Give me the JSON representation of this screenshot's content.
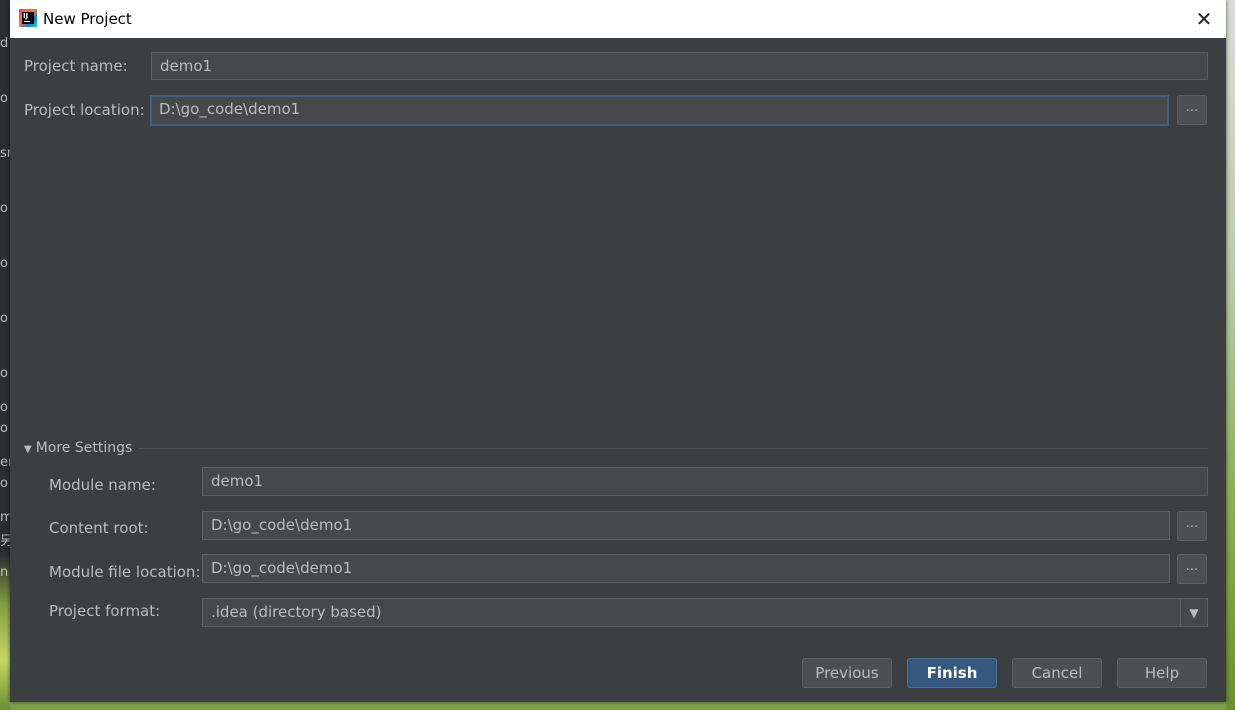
{
  "window": {
    "title": "New Project"
  },
  "background": {
    "left_chars": [
      "d",
      "o",
      "sr",
      "o",
      "o",
      "o",
      "o",
      "o",
      "o",
      "er",
      "o",
      "m",
      "另",
      "n"
    ]
  },
  "form": {
    "project_name_label": "Project name:",
    "project_name_value": "demo1",
    "project_location_label": "Project location:",
    "project_location_value": "D:\\go_code\\demo1",
    "browse_label": "..."
  },
  "more_settings": {
    "header": "More Settings",
    "module_name_label": "Module name:",
    "module_name_value": "demo1",
    "content_root_label": "Content root:",
    "content_root_value": "D:\\go_code\\demo1",
    "module_file_location_label": "Module file location:",
    "module_file_location_value": "D:\\go_code\\demo1",
    "project_format_label": "Project format:",
    "project_format_value": ".idea (directory based)"
  },
  "buttons": {
    "previous": "Previous",
    "finish": "Finish",
    "cancel": "Cancel",
    "help": "Help"
  },
  "icons": {
    "close": "close-icon",
    "dropdown": "chevron-down-icon",
    "app": "intellij-idea-logo"
  }
}
